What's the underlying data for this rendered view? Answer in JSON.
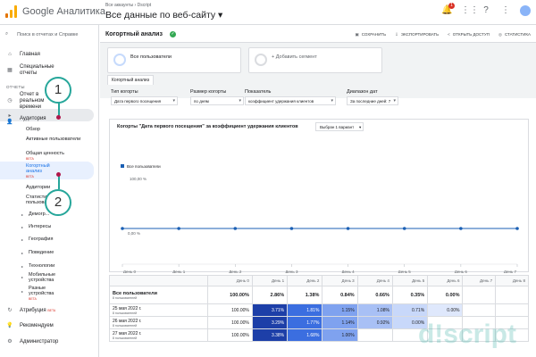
{
  "header": {
    "app_title": "Google Аналитика",
    "account_crumb": "Все аккаунты › Dscript",
    "view_title": "Все данные по веб-сайту ▾",
    "notifications_count": "1"
  },
  "sidebar": {
    "search_placeholder": "Поиск в отчетах и Справке",
    "items": {
      "home": "Главная",
      "custom_reports": "Специальные отчеты",
      "reports_label": "ОТЧЕТЫ",
      "realtime": "Отчет в реальном времени",
      "audience": "Аудитория",
      "overview": "Обзор",
      "active_users": "Активные пользователи",
      "lifetime_value": "Общая ценность",
      "cohort": "Когортный анализ",
      "audiences": "Аудитории",
      "user_explorer": "Статистика пользователей",
      "demographics": "Демогр...",
      "interests": "Интересы",
      "geo": "География",
      "behavior": "Поведение",
      "technology": "Технологии",
      "mobile": "Мобильные устройства",
      "cross_device": "Разные устройства",
      "attribution": "Атрибуция",
      "discover": "Рекомендуем",
      "admin": "Администратор",
      "beta": "BETA"
    }
  },
  "report": {
    "title": "Когортный анализ",
    "actions": [
      "СОХРАНИТЬ",
      "ЭКСПОРТИРОВАТЬ",
      "ОТКРЫТЬ ДОСТУП",
      "СТАТИСТИКА"
    ],
    "segment_1": "Все пользователи",
    "segment_add": "+ Добавить сегмент",
    "tab": "Когортный анализ"
  },
  "filters": {
    "cohort_type": {
      "label": "Тип когорты",
      "value": "Дата первого посещения"
    },
    "cohort_size": {
      "label": "Размер когорты",
      "value": "по дням"
    },
    "metric": {
      "label": "Показатель",
      "value": "коэффициент удержания клиентов"
    },
    "date_range": {
      "label": "Диапазон дат",
      "value": "За последние дней: 7"
    }
  },
  "chart": {
    "title": "Когорты \"Дата первого посещения\" за коэффициент удержания клиентов",
    "variant_button": "Выбран 1 вариант",
    "legend": "Все пользователи"
  },
  "chart_data": {
    "type": "line",
    "categories": [
      "День 0",
      "День 1",
      "День 2",
      "День 3",
      "День 4",
      "День 5",
      "День 6",
      "День 7"
    ],
    "series": [
      {
        "name": "Все пользователи",
        "values": [
          0,
          0,
          0,
          0,
          0,
          0,
          0,
          0
        ]
      }
    ],
    "y_tick_labels": [
      "100,00 %",
      "0,00 %"
    ],
    "ylim": [
      0,
      100
    ],
    "color": "#1a5fb4"
  },
  "table": {
    "headers": [
      "",
      "День 0",
      "День 1",
      "День 2",
      "День 3",
      "День 4",
      "День 5",
      "День 6",
      "День 7",
      "День 8"
    ],
    "total": {
      "label": "Все пользователи",
      "sub": "8 пользователей",
      "values": [
        "100.00%",
        "2.86%",
        "1.38%",
        "0.84%",
        "0.66%",
        "0.35%",
        "0.00%",
        "",
        ""
      ]
    },
    "rows": [
      {
        "label": "25 мая 2022 г.",
        "sub": "8 пользователей",
        "values": [
          "100.00%",
          "3.71%",
          "1.81%",
          "1.15%",
          "1.08%",
          "0.71%",
          "0.00%",
          "",
          ""
        ]
      },
      {
        "label": "26 мая 2022 г.",
        "sub": "8 пользователей",
        "values": [
          "100.00%",
          "3.29%",
          "1.77%",
          "1.14%",
          "0.92%",
          "0.00%",
          "",
          "",
          ""
        ]
      },
      {
        "label": "27 мая 2022 г.",
        "sub": "8 пользователей",
        "values": [
          "100.00%",
          "3.38%",
          "1.68%",
          "1.00%",
          "",
          "",
          "",
          "",
          ""
        ]
      }
    ]
  },
  "annotations": {
    "one": "1",
    "two": "2"
  },
  "watermark": "d!script"
}
